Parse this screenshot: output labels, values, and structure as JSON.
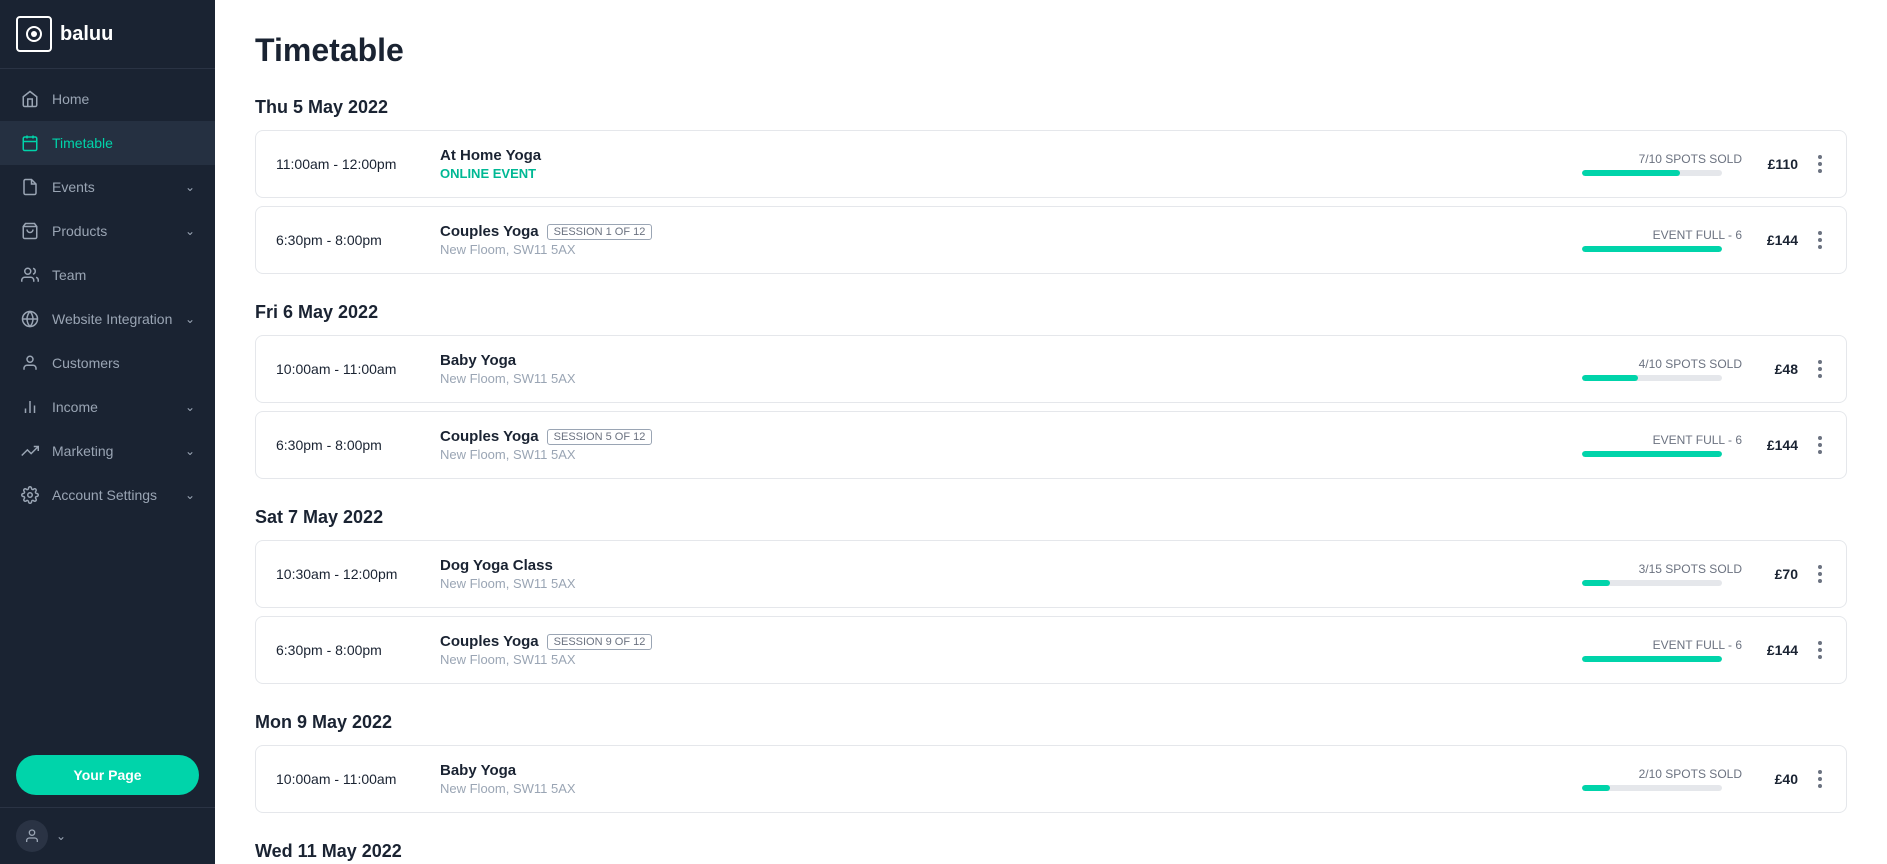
{
  "logo": {
    "icon": "⊙",
    "text": "baluu"
  },
  "sidebar": {
    "items": [
      {
        "id": "home",
        "label": "Home",
        "icon": "home",
        "active": false,
        "hasChevron": false
      },
      {
        "id": "timetable",
        "label": "Timetable",
        "icon": "calendar",
        "active": true,
        "hasChevron": false
      },
      {
        "id": "events",
        "label": "Events",
        "icon": "events",
        "active": false,
        "hasChevron": true
      },
      {
        "id": "products",
        "label": "Products",
        "icon": "products",
        "active": false,
        "hasChevron": true
      },
      {
        "id": "team",
        "label": "Team",
        "icon": "team",
        "active": false,
        "hasChevron": false
      },
      {
        "id": "website-integration",
        "label": "Website Integration",
        "icon": "website",
        "active": false,
        "hasChevron": true
      },
      {
        "id": "customers",
        "label": "Customers",
        "icon": "customers",
        "active": false,
        "hasChevron": false
      },
      {
        "id": "income",
        "label": "Income",
        "icon": "income",
        "active": false,
        "hasChevron": true
      },
      {
        "id": "marketing",
        "label": "Marketing",
        "icon": "marketing",
        "active": false,
        "hasChevron": true
      },
      {
        "id": "account-settings",
        "label": "Account Settings",
        "icon": "settings",
        "active": false,
        "hasChevron": true
      }
    ],
    "your_page_label": "Your Page"
  },
  "page_title": "Timetable",
  "days": [
    {
      "heading": "Thu 5 May 2022",
      "events": [
        {
          "time": "11:00am - 12:00pm",
          "name": "At Home Yoga",
          "sub_label": "ONLINE EVENT",
          "sub_type": "online",
          "location": "",
          "session_label": "",
          "spots_label": "7/10 SPOTS SOLD",
          "spots_filled": 70,
          "price": "£110",
          "event_full": false
        },
        {
          "time": "6:30pm - 8:00pm",
          "name": "Couples Yoga",
          "sub_label": "",
          "sub_type": "",
          "location": "New Floom, SW11 5AX",
          "session_label": "SESSION 1 OF 12",
          "spots_label": "EVENT FULL - 6",
          "spots_filled": 100,
          "price": "£144",
          "event_full": true
        }
      ]
    },
    {
      "heading": "Fri 6 May 2022",
      "events": [
        {
          "time": "10:00am - 11:00am",
          "name": "Baby Yoga",
          "sub_label": "",
          "sub_type": "",
          "location": "New Floom, SW11 5AX",
          "session_label": "",
          "spots_label": "4/10 SPOTS SOLD",
          "spots_filled": 40,
          "price": "£48",
          "event_full": false
        },
        {
          "time": "6:30pm - 8:00pm",
          "name": "Couples Yoga",
          "sub_label": "",
          "sub_type": "",
          "location": "New Floom, SW11 5AX",
          "session_label": "SESSION 5 OF 12",
          "spots_label": "EVENT FULL - 6",
          "spots_filled": 100,
          "price": "£144",
          "event_full": true
        }
      ]
    },
    {
      "heading": "Sat 7 May 2022",
      "events": [
        {
          "time": "10:30am - 12:00pm",
          "name": "Dog Yoga Class",
          "sub_label": "",
          "sub_type": "",
          "location": "New Floom, SW11 5AX",
          "session_label": "",
          "spots_label": "3/15 SPOTS SOLD",
          "spots_filled": 20,
          "price": "£70",
          "event_full": false
        },
        {
          "time": "6:30pm - 8:00pm",
          "name": "Couples Yoga",
          "sub_label": "",
          "sub_type": "",
          "location": "New Floom, SW11 5AX",
          "session_label": "SESSION 9 OF 12",
          "spots_label": "EVENT FULL - 6",
          "spots_filled": 100,
          "price": "£144",
          "event_full": true
        }
      ]
    },
    {
      "heading": "Mon 9 May 2022",
      "events": [
        {
          "time": "10:00am - 11:00am",
          "name": "Baby Yoga",
          "sub_label": "",
          "sub_type": "",
          "location": "New Floom, SW11 5AX",
          "session_label": "",
          "spots_label": "2/10 SPOTS SOLD",
          "spots_filled": 20,
          "price": "£40",
          "event_full": false
        }
      ]
    },
    {
      "heading": "Wed 11 May 2022",
      "events": []
    }
  ]
}
